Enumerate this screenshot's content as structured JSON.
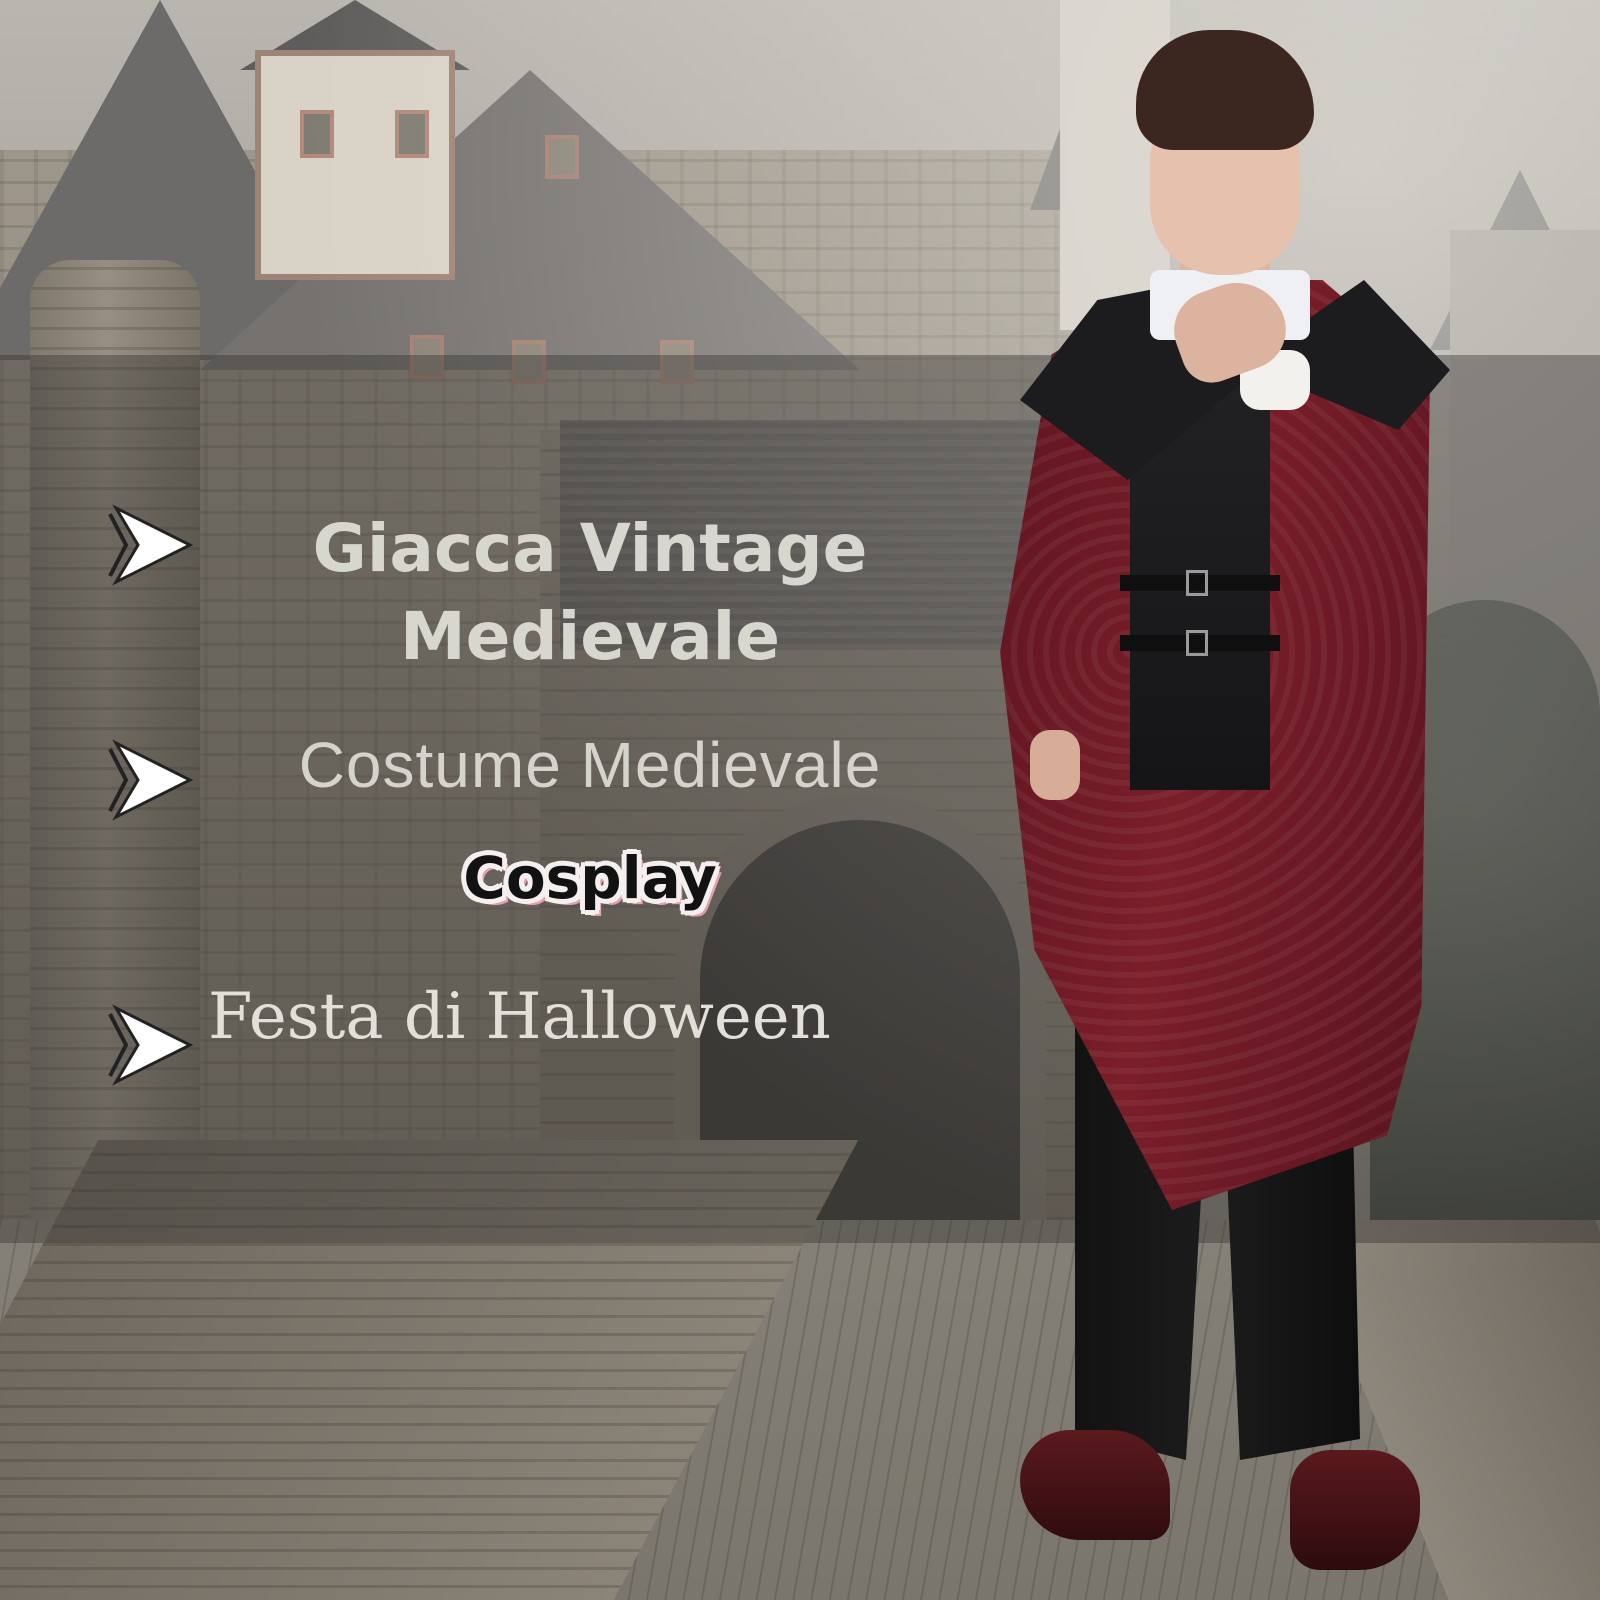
{
  "headline": {
    "line1": "Giacca Vintage",
    "line2": "Medievale"
  },
  "features": {
    "costume": "Costume Medievale",
    "cosplay": "Cosplay",
    "festa": "Festa di Halloween"
  },
  "icons": {
    "bullet": "double-chevron-right-icon"
  },
  "colors": {
    "coat": "#6e1a25",
    "text_light": "#d8d7cf",
    "cosplay_text": "#121212",
    "cosplay_outline": "#f5eff0",
    "band": "rgba(55,53,50,0.42)"
  }
}
